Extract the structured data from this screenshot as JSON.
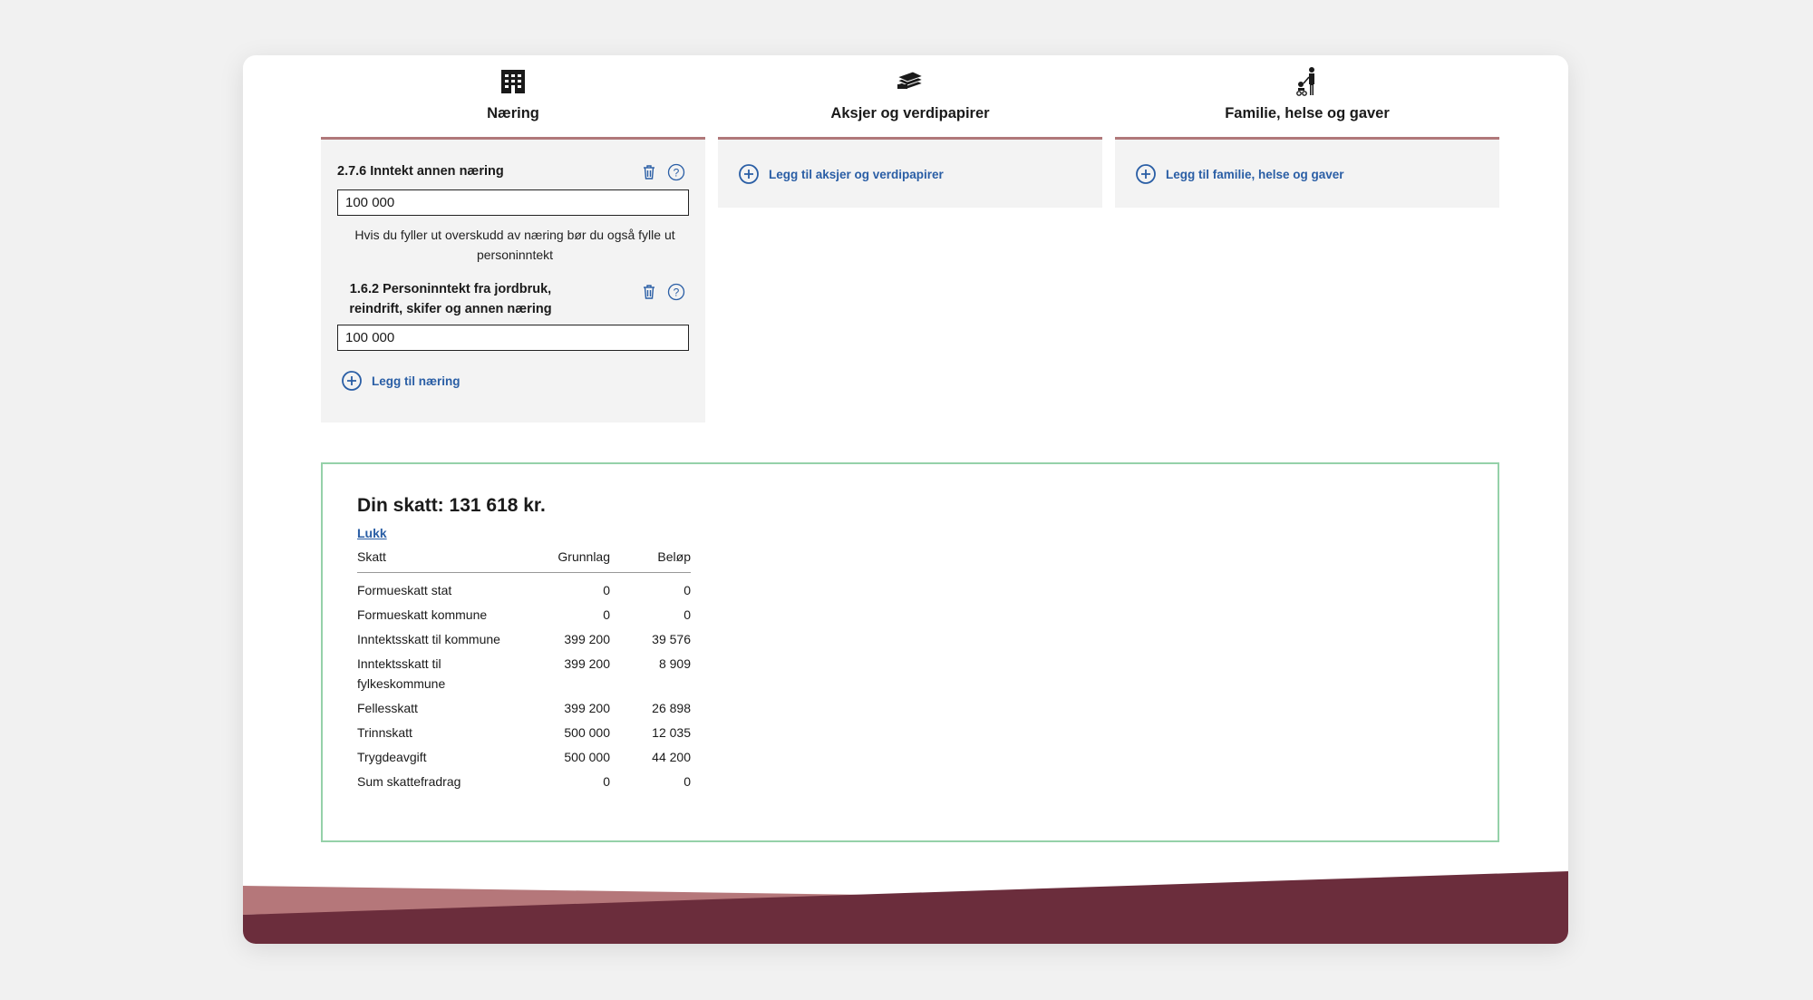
{
  "colors": {
    "accent_line": "#b0787a",
    "link": "#2a5ea5",
    "result_border": "#95d1a9",
    "footer_light": "#b5777a",
    "footer_dark": "#6b2d3c",
    "panel_bg": "#f3f3f3"
  },
  "categories": [
    {
      "title": "Næring",
      "icon": "building-icon",
      "fields": [
        {
          "label": "2.7.6 Inntekt annen næring",
          "value": "100 000",
          "help": "Hvis du fyller ut overskudd av næring bør du også fylle ut personinntekt"
        },
        {
          "label": "1.6.2 Personinntekt fra jordbruk, reindrift, skifer og annen næring",
          "value": "100 000"
        }
      ],
      "add_label": "Legg til næring"
    },
    {
      "title": "Aksjer og verdipapirer",
      "icon": "money-stack-icon",
      "add_label": "Legg til aksjer og verdipapirer"
    },
    {
      "title": "Familie, helse og gaver",
      "icon": "family-icon",
      "add_label": "Legg til familie, helse og gaver"
    }
  ],
  "result": {
    "title": "Din skatt: 131 618 kr.",
    "close_label": "Lukk",
    "columns": [
      "Skatt",
      "Grunnlag",
      "Beløp"
    ],
    "rows": [
      {
        "name": "Formueskatt stat",
        "base": "0",
        "amount": "0"
      },
      {
        "name": "Formueskatt kommune",
        "base": "0",
        "amount": "0"
      },
      {
        "name": "Inntektsskatt til kommune",
        "base": "399 200",
        "amount": "39 576"
      },
      {
        "name": "Inntektsskatt til fylkeskommune",
        "base": "399 200",
        "amount": "8 909"
      },
      {
        "name": "Fellesskatt",
        "base": "399 200",
        "amount": "26 898"
      },
      {
        "name": "Trinnskatt",
        "base": "500 000",
        "amount": "12 035"
      },
      {
        "name": "Trygdeavgift",
        "base": "500 000",
        "amount": "44 200"
      },
      {
        "name": "Sum skattefradrag",
        "base": "0",
        "amount": "0"
      }
    ]
  }
}
